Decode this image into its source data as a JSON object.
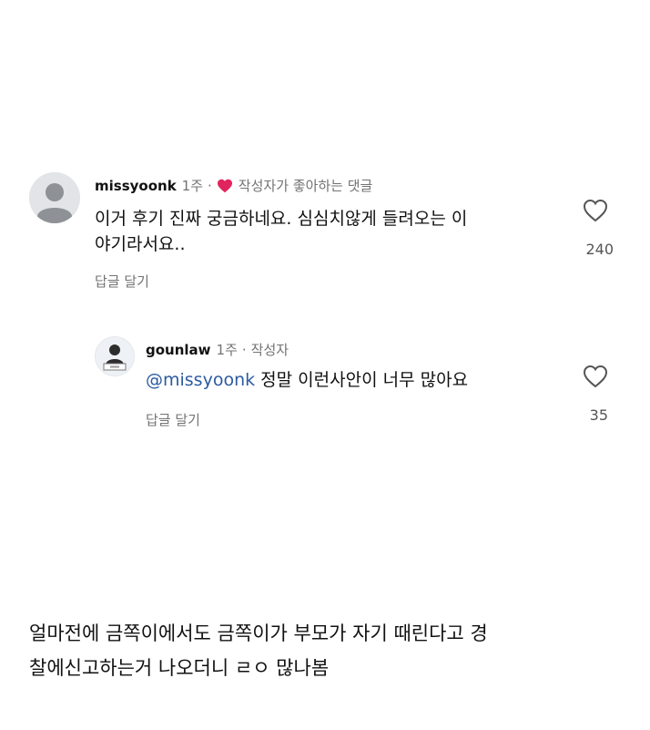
{
  "comments": [
    {
      "username": "missyoonk",
      "time": "1주",
      "separator": "·",
      "badge": "작성자가 좋아하는 댓글",
      "text_line1": "이거 후기 진짜 궁금하네요. 심심치않게 들려오는 이",
      "text_line2": "야기라서요..",
      "reply_label": "답글 달기",
      "likes": "240",
      "badge_color": "#e0245e"
    }
  ],
  "reply": {
    "username": "gounlaw",
    "time": "1주",
    "separator": "·",
    "role": "작성자",
    "mention": "@missyoonk",
    "text": " 정말 이런사안이 너무 많아요",
    "reply_label": "답글 달기",
    "likes": "35"
  },
  "caption": {
    "line1": "얼마전에 금쪽이에서도 금쪽이가 부모가 자기 때린다고 경",
    "line2": "찰에신고하는거 나오더니 ㄹㅇ 많나봄"
  },
  "icons": {
    "avatar_default": "default-avatar-icon",
    "heart_badge": "heart-filled-icon",
    "like": "heart-outline-icon"
  }
}
